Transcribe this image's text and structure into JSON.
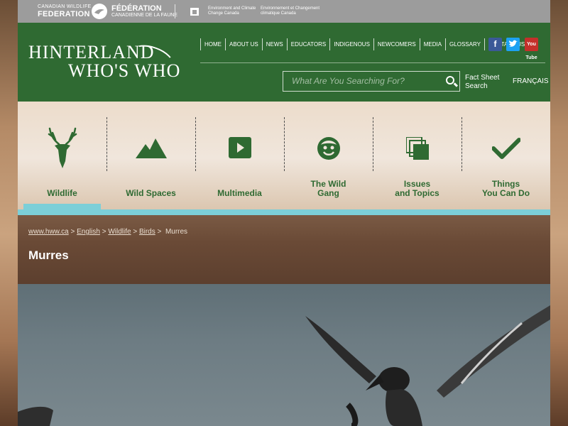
{
  "topbar": {
    "cwf_en_small": "CANADIAN WILDLIFE",
    "cwf_en_big": "FEDERATION",
    "cwf_fr_big": "FÉDÉRATION",
    "cwf_fr_small": "CANADIENNE DE LA FAUNE",
    "eccc_en": "Environment and Climate Change Canada",
    "eccc_fr": "Environnement et Changement climatique Canada"
  },
  "header": {
    "logo_line1": "HINTERLAND",
    "logo_line2": "WHO'S WHO",
    "nav": [
      "HOME",
      "ABOUT US",
      "NEWS",
      "EDUCATORS",
      "INDIGENOUS",
      "NEWCOMERS",
      "MEDIA",
      "GLOSSARY",
      "CONTACT US"
    ],
    "search_placeholder": "What Are You Searching For?",
    "fact_sheet_line1": "Fact Sheet",
    "fact_sheet_line2": "Search",
    "language": "FRANÇAIS",
    "social": {
      "facebook": "f",
      "twitter": "t",
      "youtube": "You Tube"
    }
  },
  "tiles": [
    {
      "label_line1": "Wildlife",
      "label_line2": "",
      "icon": "deer-icon",
      "active": true
    },
    {
      "label_line1": "Wild Spaces",
      "label_line2": "",
      "icon": "mountain-icon",
      "active": false
    },
    {
      "label_line1": "Multimedia",
      "label_line2": "",
      "icon": "play-icon",
      "active": false
    },
    {
      "label_line1": "The Wild",
      "label_line2": "Gang",
      "icon": "face-icon",
      "active": false
    },
    {
      "label_line1": "Issues",
      "label_line2": "and Topics",
      "icon": "stack-icon",
      "active": false
    },
    {
      "label_line1": "Things",
      "label_line2": "You Can Do",
      "icon": "checkmark-icon",
      "active": false
    }
  ],
  "breadcrumb": {
    "items": [
      "www.hww.ca",
      "English",
      "Wildlife",
      "Birds"
    ],
    "current": "Murres"
  },
  "page_title": "Murres",
  "colors": {
    "brand_green": "#2f6a32",
    "accent_cyan": "#7ccfd8"
  }
}
